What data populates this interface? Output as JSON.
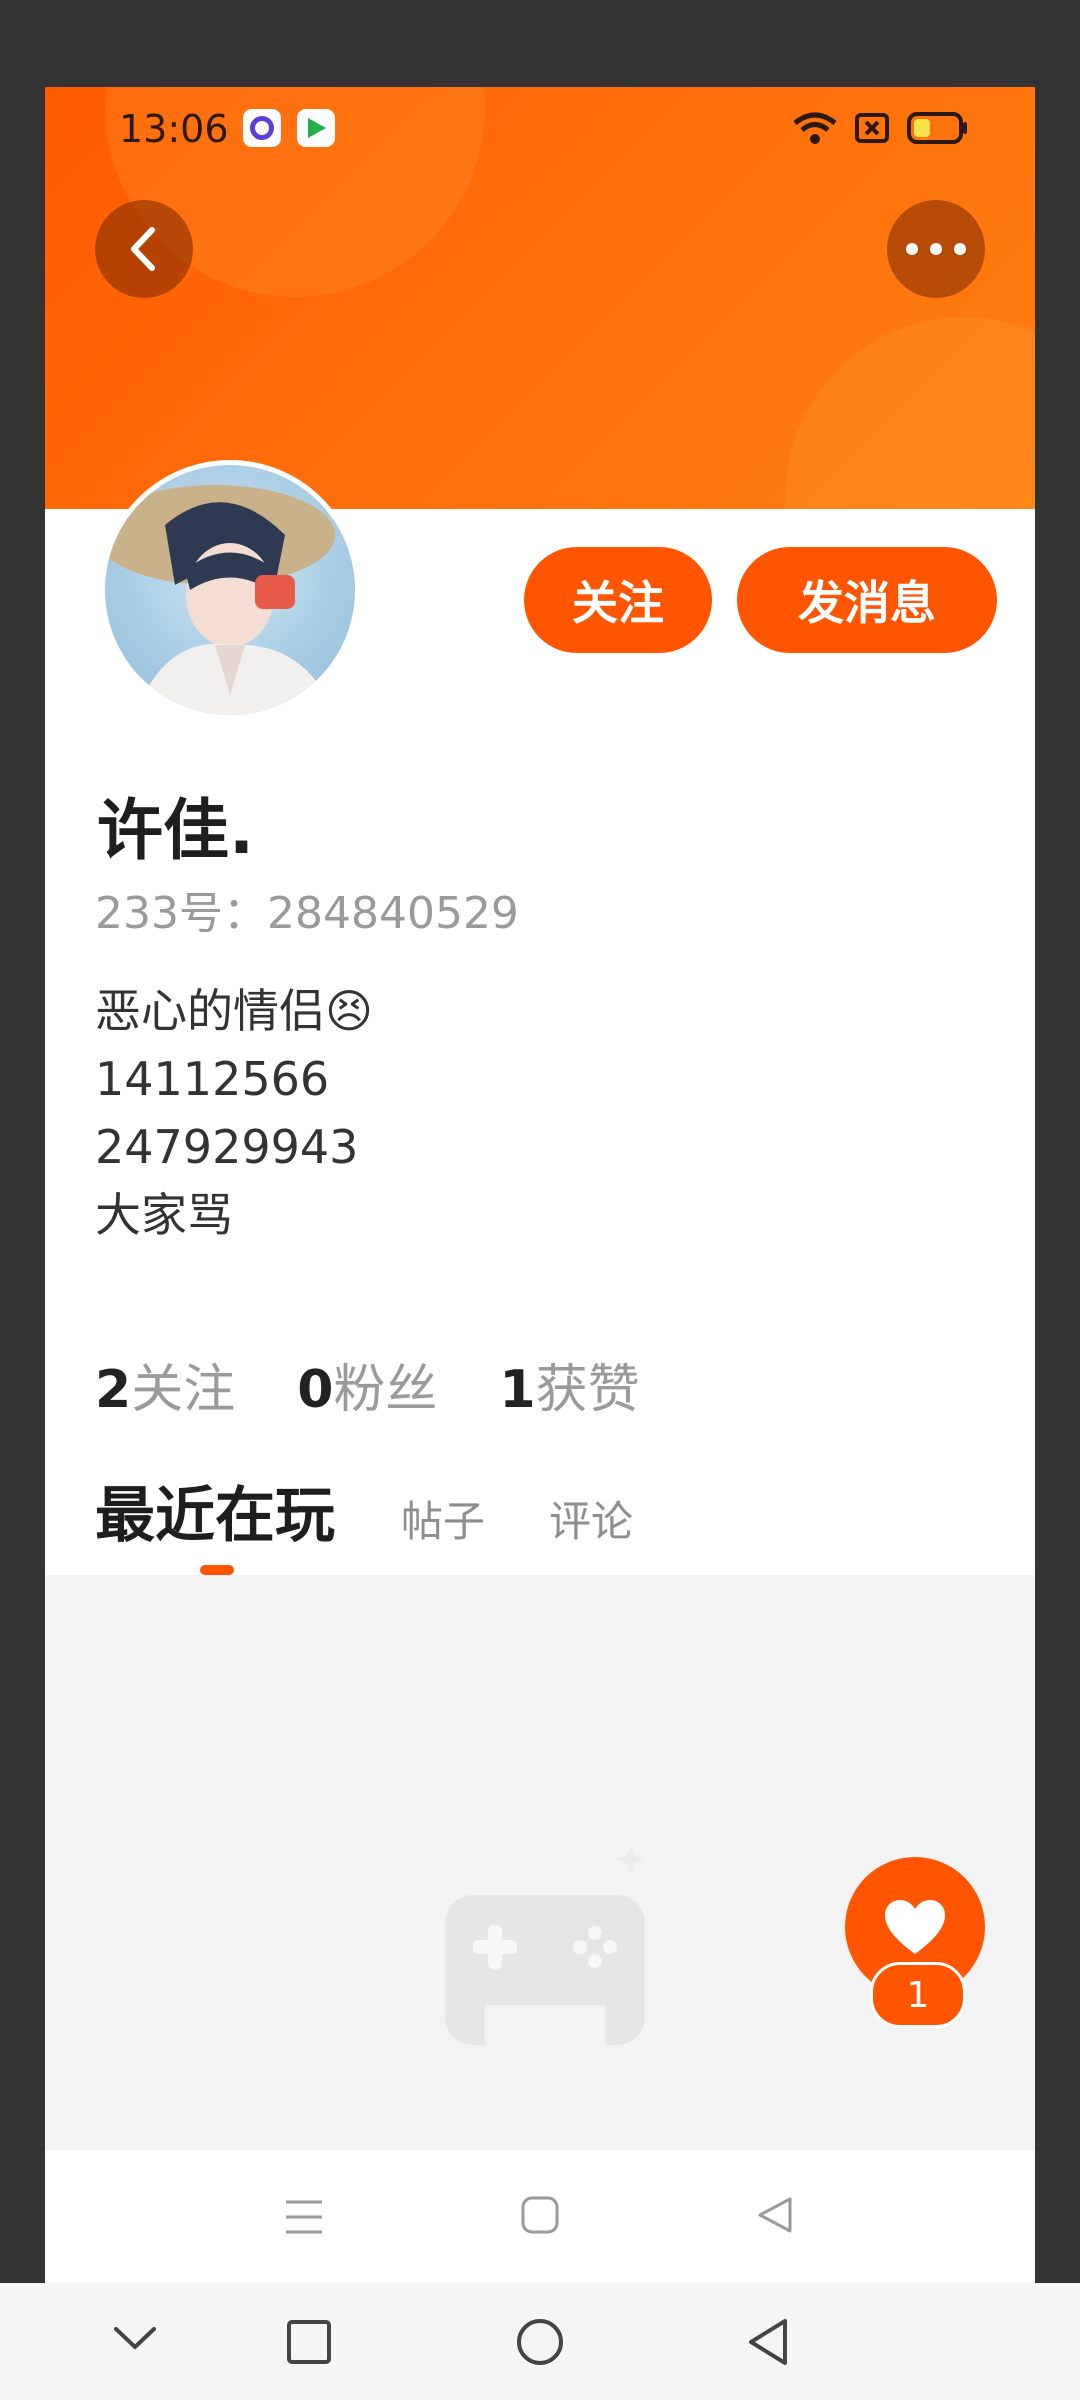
{
  "status_bar": {
    "time": "13:06"
  },
  "profile": {
    "name": "许佳.",
    "uid": "233号：284840529",
    "bio_lines": [
      "恶心的情侣😣",
      "14112566",
      "247929943",
      "大家骂"
    ]
  },
  "actions": {
    "follow": "关注",
    "message": "发消息"
  },
  "stats": {
    "following_count": "2",
    "following_label": "关注",
    "fans_count": "0",
    "fans_label": "粉丝",
    "likes_count": "1",
    "likes_label": "获赞"
  },
  "tabs": {
    "active": "最近在玩",
    "posts": "帖子",
    "comments": "评论"
  },
  "fab": {
    "badge": "1"
  },
  "colors": {
    "accent": "#ff5400",
    "banner": "#ff6d0a"
  }
}
